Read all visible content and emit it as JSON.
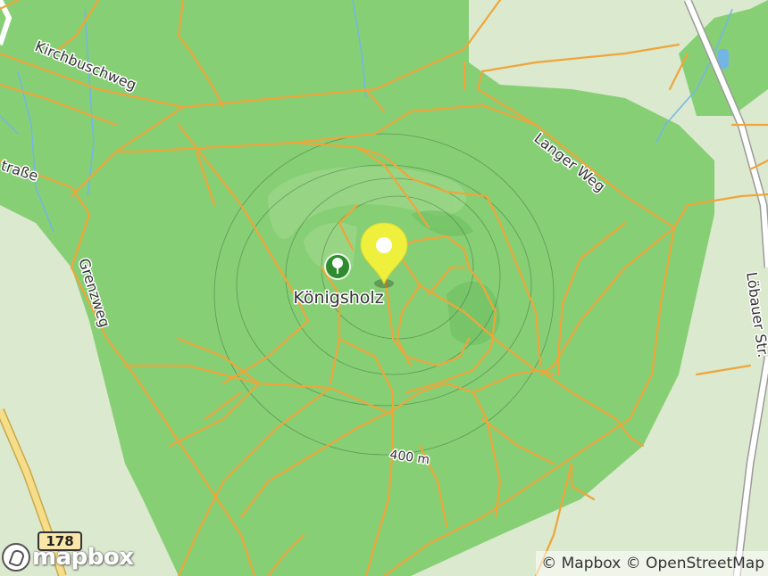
{
  "map": {
    "labels": {
      "poi": "Königsholz",
      "kirchbuschweg": "Kirchbuschweg",
      "langer_weg": "Langer Weg",
      "grenzweg": "Grenzweg",
      "strasse_partial": "traße",
      "loebauer": "Löbauer Str.",
      "contour": "400 m"
    },
    "road_shield": "178",
    "logo": "mapbox",
    "attribution": {
      "mapbox": "© Mapbox",
      "osm": "© OpenStreetMap"
    },
    "colors": {
      "forest": "#86cf75",
      "meadow": "#dbe9cf",
      "track": "#f0a53a",
      "marker": "#eef03b",
      "poi_icon": "#2e8b2e",
      "water": "#73b6e6"
    },
    "icons": {
      "marker": "map-pin-icon",
      "poi": "tree-icon",
      "logo": "mapbox-logo-icon"
    }
  }
}
